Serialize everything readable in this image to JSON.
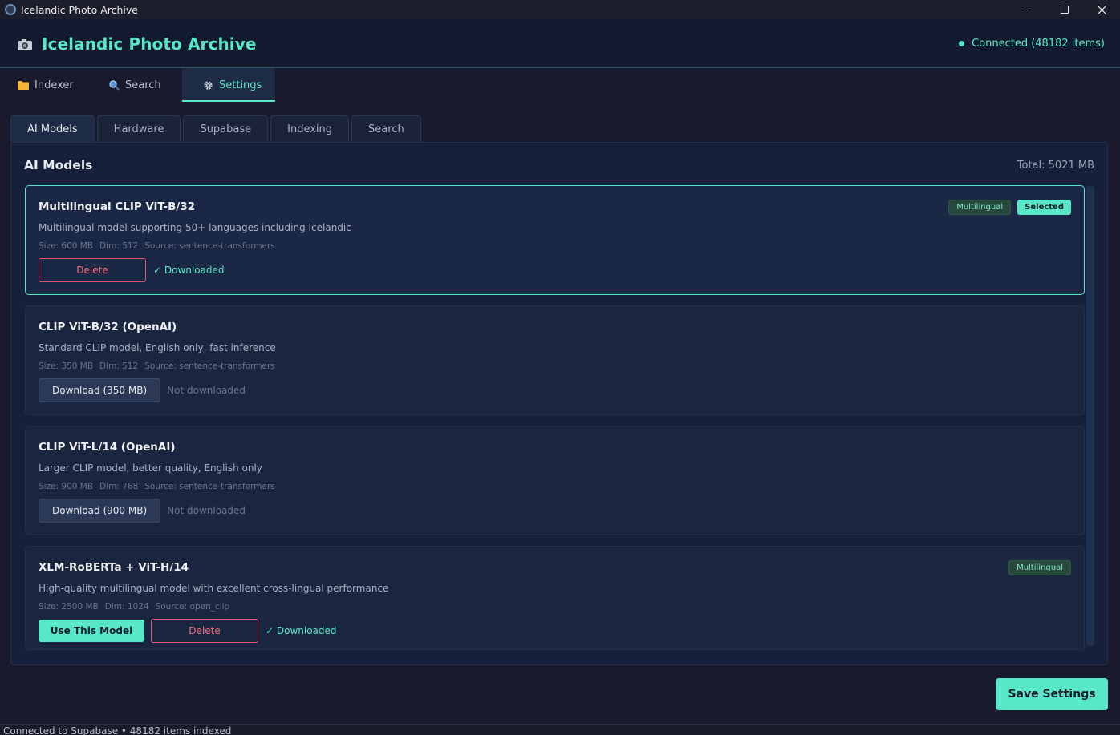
{
  "window": {
    "title": "Icelandic Photo Archive"
  },
  "header": {
    "app_title": "Icelandic Photo Archive",
    "status": "Connected (48182 items)",
    "accent_color": "#58e8c8"
  },
  "main_tabs": [
    {
      "label": "Indexer",
      "icon": "folder-icon"
    },
    {
      "label": "Search",
      "icon": "magnifier-icon"
    },
    {
      "label": "Settings",
      "icon": "gear-icon",
      "active": true
    }
  ],
  "sub_tabs": [
    {
      "label": "AI Models",
      "active": true
    },
    {
      "label": "Hardware"
    },
    {
      "label": "Supabase"
    },
    {
      "label": "Indexing"
    },
    {
      "label": "Search"
    }
  ],
  "panel": {
    "title": "AI Models",
    "total": "Total: 5021 MB"
  },
  "models": [
    {
      "name": "Multilingual CLIP ViT-B/32",
      "description": "Multilingual model supporting 50+ languages including Icelandic",
      "size": "Size: 600 MB",
      "dim": "Dim: 512",
      "source": "Source: sentence-transformers",
      "badge_multilingual": "Multilingual",
      "badge_selected": "Selected",
      "delete_label": "Delete",
      "state": "✓ Downloaded"
    },
    {
      "name": "CLIP ViT-B/32 (OpenAI)",
      "description": "Standard CLIP model, English only, fast inference",
      "size": "Size: 350 MB",
      "dim": "Dim: 512",
      "source": "Source: sentence-transformers",
      "download_label": "Download (350 MB)",
      "state": "Not downloaded"
    },
    {
      "name": "CLIP ViT-L/14 (OpenAI)",
      "description": "Larger CLIP model, better quality, English only",
      "size": "Size: 900 MB",
      "dim": "Dim: 768",
      "source": "Source: sentence-transformers",
      "download_label": "Download (900 MB)",
      "state": "Not downloaded"
    },
    {
      "name": "XLM-RoBERTa + ViT-H/14",
      "description": "High-quality multilingual model with excellent cross-lingual performance",
      "size": "Size: 2500 MB",
      "dim": "Dim: 1024",
      "source": "Source: open_clip",
      "badge_multilingual": "Multilingual",
      "use_label": "Use This Model",
      "delete_label": "Delete",
      "state": "✓ Downloaded"
    }
  ],
  "save_label": "Save Settings",
  "statusbar": "Connected to Supabase • 48182 items indexed"
}
